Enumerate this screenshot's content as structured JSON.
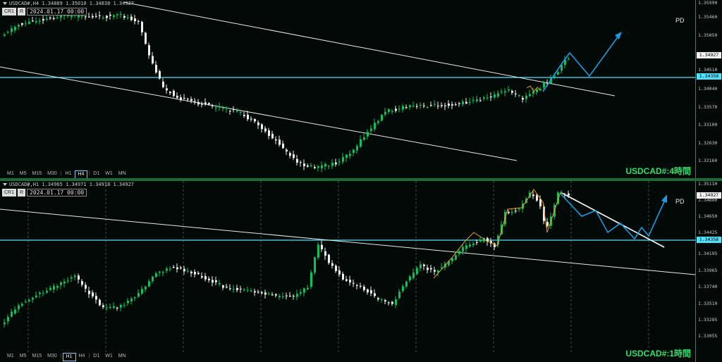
{
  "top": {
    "header_text": "USDCAD#,H4  1.34889 1.35010 1.34838 1.34927",
    "tag_cr": "CR1",
    "tag_r": "R",
    "date_text": "2024.01.17 00:00",
    "timeframes": [
      "M1",
      "M5",
      "M15",
      "M30",
      "H1",
      "H4",
      "D1",
      "W1",
      "MN"
    ],
    "active_timeframe": "H4",
    "title": "USDCAD#:4時間",
    "pd_label": "PD",
    "price_ticks": [
      "1.35990",
      "1.35460",
      "1.35050",
      "1.34510",
      "1.34040",
      "1.33570",
      "1.33100",
      "1.32630",
      "1.32160"
    ],
    "current_price_label": "1.34927",
    "level_label": "1.34358"
  },
  "bottom": {
    "header_text": "USDCAD#,H1  1.34965 1.34971 1.34918 1.34927",
    "tag_cr": "CR1",
    "tag_r": "R",
    "date_text": "2024.01.17 00:00",
    "timeframes": [
      "M1",
      "M5",
      "M15",
      "M30",
      "H1",
      "H4",
      "D1",
      "W1",
      "MN"
    ],
    "active_timeframe": "H1",
    "title": "USDCAD#:1時間",
    "pd_label": "PD",
    "price_ticks": [
      "1.35110",
      "1.34880",
      "1.34650",
      "1.34425",
      "1.34195",
      "1.33965",
      "1.33740",
      "1.33510",
      "1.33285",
      "1.33055"
    ],
    "current_price_label": "1.34927",
    "level_label": "1.34358"
  },
  "colors": {
    "background": "#020a07",
    "bull_candle": "#0fc15a",
    "bear_candle": "#f2f2f2",
    "level_line": "#4de3ff",
    "forecast_line": "#1e9be0",
    "wave_line": "#e8a020",
    "title": "#2ee06a"
  }
}
